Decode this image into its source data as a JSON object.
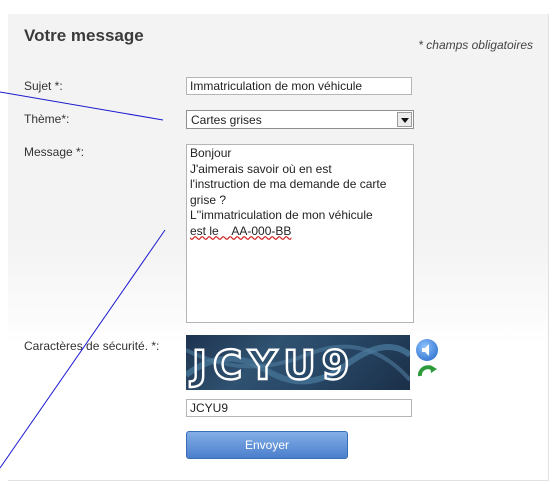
{
  "form": {
    "title": "Votre message",
    "required_note": "* champs obligatoires",
    "subject": {
      "label": "Sujet *:",
      "value": "Immatriculation de mon véhicule"
    },
    "theme": {
      "label": "Thème*:",
      "selected": "Cartes grises"
    },
    "message": {
      "label": "Message *:",
      "lines": [
        "Bonjour",
        "J'aimerais savoir où en est",
        "l'instruction de ma demande de carte",
        "grise ?",
        "L''immatriculation de mon véhicule",
        "est le    AA-000-BB"
      ]
    },
    "captcha": {
      "label": "Caractères de sécurité. *:",
      "image_text": "JCYU9",
      "value": "JCYU9",
      "audio_icon": "speaker-icon",
      "refresh_icon": "refresh-icon"
    },
    "submit_label": "Envoyer"
  },
  "colors": {
    "annotation_line": "#1a1ad0",
    "button": "#4b7fcd",
    "captcha_bg": "#243f5e"
  }
}
